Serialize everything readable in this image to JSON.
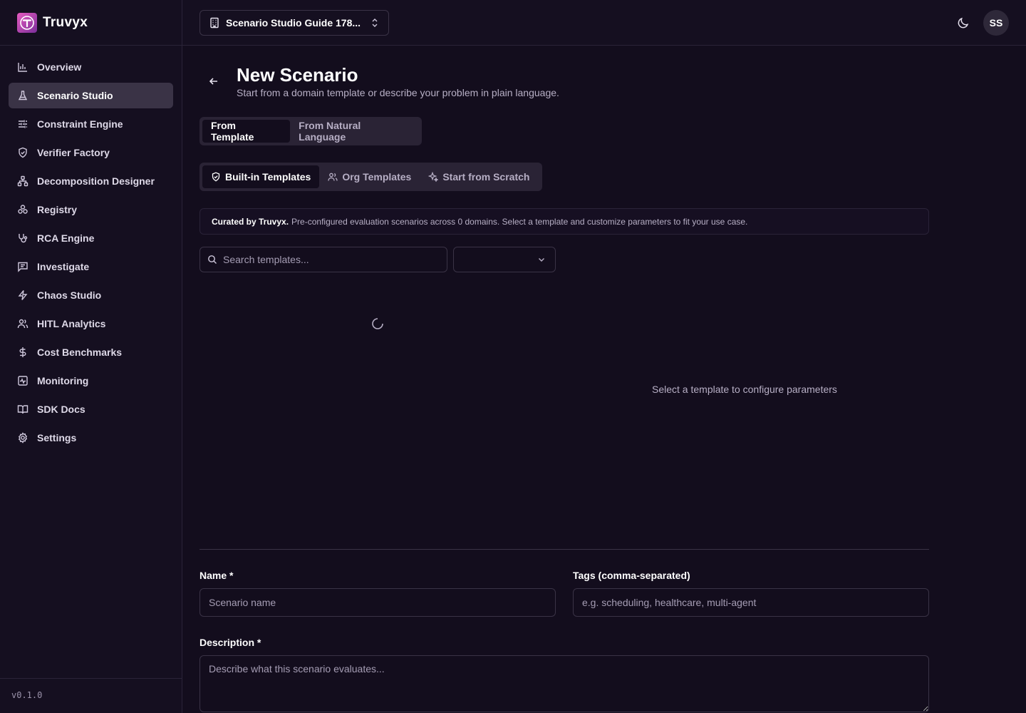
{
  "brand": {
    "name": "Truvyx",
    "logo_letter": "T"
  },
  "sidebar": {
    "items": [
      {
        "label": "Overview",
        "icon": "bar-chart-icon",
        "active": false
      },
      {
        "label": "Scenario Studio",
        "icon": "flask-icon",
        "active": true
      },
      {
        "label": "Constraint Engine",
        "icon": "sliders-icon",
        "active": false
      },
      {
        "label": "Verifier Factory",
        "icon": "shield-check-icon",
        "active": false
      },
      {
        "label": "Decomposition Designer",
        "icon": "network-icon",
        "active": false
      },
      {
        "label": "Registry",
        "icon": "boxes-icon",
        "active": false
      },
      {
        "label": "RCA Engine",
        "icon": "stethoscope-icon",
        "active": false
      },
      {
        "label": "Investigate",
        "icon": "message-square-icon",
        "active": false
      },
      {
        "label": "Chaos Studio",
        "icon": "zap-icon",
        "active": false
      },
      {
        "label": "HITL Analytics",
        "icon": "users-icon",
        "active": false
      },
      {
        "label": "Cost Benchmarks",
        "icon": "dollar-icon",
        "active": false
      },
      {
        "label": "Monitoring",
        "icon": "activity-icon",
        "active": false
      },
      {
        "label": "SDK Docs",
        "icon": "book-open-icon",
        "active": false
      },
      {
        "label": "Settings",
        "icon": "gear-icon",
        "active": false
      }
    ],
    "version": "v0.1.0"
  },
  "topbar": {
    "project": "Scenario Studio Guide 178...",
    "avatar_initials": "SS"
  },
  "page": {
    "title": "New Scenario",
    "subtitle": "Start from a domain template or describe your problem in plain language."
  },
  "mode_tabs": {
    "template": "From Template",
    "natural": "From Natural Language"
  },
  "source_tabs": {
    "builtin": "Built-in Templates",
    "org": "Org Templates",
    "scratch": "Start from Scratch"
  },
  "curated": {
    "strong": "Curated by Truvyx.",
    "text": "Pre-configured evaluation scenarios across 0 domains. Select a template and customize parameters to fit your use case."
  },
  "search": {
    "placeholder": "Search templates...",
    "value": ""
  },
  "domain_filter": {
    "value": ""
  },
  "params_empty": "Select a template to configure parameters",
  "form": {
    "name_label": "Name *",
    "name_placeholder": "Scenario name",
    "tags_label": "Tags (comma-separated)",
    "tags_placeholder": "e.g. scheduling, healthcare, multi-agent",
    "desc_label": "Description *",
    "desc_placeholder": "Describe what this scenario evaluates..."
  },
  "colors": {
    "background": "#130d1d",
    "sidebar": "#150f20",
    "active_nav": "#3a3346",
    "brand_gradient_start": "#e65cc0",
    "brand_gradient_end": "#7b2e9a"
  }
}
